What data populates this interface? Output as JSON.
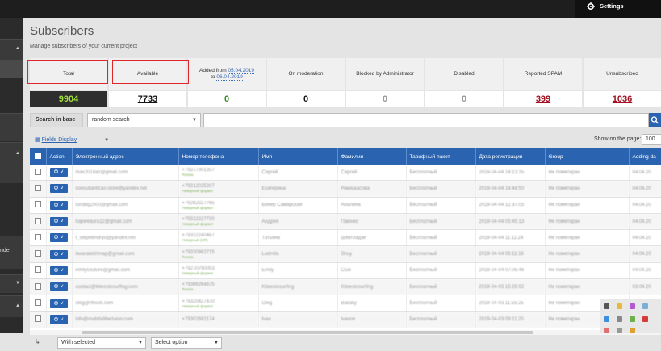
{
  "header": {
    "settings_label": "Settings"
  },
  "sidebar": {
    "partial_text": "nder"
  },
  "page": {
    "title": "Subscribers",
    "subtitle": "Manage subscribers of your current project"
  },
  "stats": {
    "total": {
      "label": "Total",
      "value": "9904"
    },
    "available": {
      "label": "Available",
      "value": "7733"
    },
    "added": {
      "label_prefix": "Added from",
      "date_from": "05.04.2019",
      "label_to": "to",
      "date_to": "06.04.2019",
      "value": "0"
    },
    "moderation": {
      "label": "On moderation",
      "value": "0"
    },
    "blocked": {
      "label": "Blocked by Administrator",
      "value": "0"
    },
    "disabled": {
      "label": "Disabled",
      "value": "0"
    },
    "spam": {
      "label": "Reported SPAM",
      "value": "399"
    },
    "unsubscribed": {
      "label": "Unsubscribed",
      "value": "1036"
    }
  },
  "search": {
    "label": "Search in base",
    "mode": "random search",
    "query": ""
  },
  "fields_display": "Fields Display",
  "show_on_page": {
    "label": "Show on the page:",
    "value": "100"
  },
  "table": {
    "columns": [
      "Action",
      "Электронный адрес",
      "Номер телефона",
      "Имя",
      "Фамилия",
      "Тарифный пакет",
      "Дата регистрации",
      "Group",
      "Adding da"
    ],
    "rows": [
      {
        "email": "max2018az@gmail.com",
        "phone": "+79377301357",
        "phone_sub": "Russia",
        "name": "Сергей",
        "surname": "Сергей",
        "plan": "Бесплатный",
        "date": "2019-04-04 14:13:15",
        "group": "Не пометиран",
        "added": "04.04.20"
      },
      {
        "email": "consultanticas.store@yandex.net",
        "phone": "+79312025207",
        "phone_sub": "Неверный формат",
        "name": "Екатерина",
        "surname": "Ракицкасова",
        "plan": "Бесплатный",
        "date": "2019-04-04 14:44:50",
        "group": "Не пометиран",
        "added": "04.04.20"
      },
      {
        "email": "fondog2000@gmail.com",
        "phone": "+79262327765",
        "phone_sub": "Неверный формат",
        "name": "Бенер Самарская",
        "surname": "Аналина",
        "plan": "Бесплатный",
        "date": "2019-04-04 12:37:05",
        "group": "Не пометиран",
        "added": "04.04.20"
      },
      {
        "email": "hapweaura12@gmail.com",
        "phone": "+79332227730",
        "phone_sub": "Неверный формат",
        "name": "Андрей",
        "surname": "Паюнко",
        "plan": "Бесплатный",
        "date": "2019-04-04 05:45:13",
        "group": "Не пометиран",
        "added": "04.04.20"
      },
      {
        "email": "t_stephilindryu@yandex.net",
        "phone": "+79332240487",
        "phone_sub": "Неверный (UR)",
        "name": "Татьяна",
        "surname": "Шевтладзе",
        "plan": "Бесплатный",
        "date": "2019-04-04 11:11:24",
        "group": "Не пометиран",
        "added": "04.04.20"
      },
      {
        "email": "ilwanalekhmap@gmail.com",
        "phone": "+79330862715",
        "phone_sub": "Russia",
        "name": "Ludmila",
        "surname": "Shuy",
        "plan": "Бесплатный",
        "date": "2019-04-04 06:11:18",
        "group": "Не пометиран",
        "added": "04.04.20"
      },
      {
        "email": "emilycouture@gmail.com",
        "phone": "+79270790053",
        "phone_sub": "Неверный формат",
        "name": "Emily",
        "surname": "Club",
        "plan": "Бесплатный",
        "date": "2019-04-04 07:05:46",
        "group": "Не пометиран",
        "added": "04.04.20"
      },
      {
        "email": "contact@kiteestosurfing.com",
        "phone": "+79366264675",
        "phone_sub": "Russia",
        "name": "Kiteestosurfing",
        "surname": "Kiteestosurfing",
        "plan": "Бесплатный",
        "date": "2019-04-03 15:26:02",
        "group": "Не пометиран",
        "added": "03.04.20"
      },
      {
        "email": "oleg@rthsoti.com",
        "phone": "+79320427470",
        "phone_sub": "Неверный формат",
        "name": "Oleg",
        "surname": "Bakaliy",
        "plan": "Бесплатный",
        "date": "2019-04-03 11:55:25",
        "group": "Не пометиран",
        "added": "03.04.20"
      },
      {
        "email": "info@mabdalibertaion.com",
        "phone": "+79302692174",
        "phone_sub": "",
        "name": "Ivan",
        "surname": "Ivanov",
        "plan": "Бесплатный",
        "date": "2019-04-03 09:11:20",
        "group": "Не пометиран",
        "added": "03.04.20"
      }
    ]
  },
  "footer": {
    "with_selected": "With selected",
    "select_option": "Select option"
  },
  "colors": {
    "accent": "#2a64b0",
    "highlight_box": "#e0242c",
    "total_value": "#9fe03a",
    "added_value": "#3a8a2a",
    "spam_value": "#a01020"
  }
}
